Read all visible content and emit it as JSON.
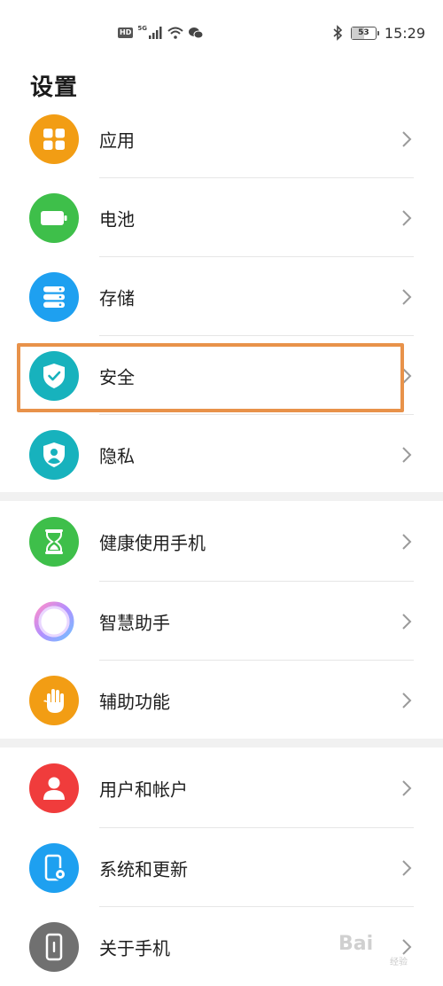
{
  "status_bar": {
    "hd": "HD",
    "network": "5G",
    "time": "15:29",
    "battery_percent": "53",
    "battery_level": 0.53
  },
  "page": {
    "title": "设置"
  },
  "items": [
    {
      "label": "应用",
      "icon": "apps-icon",
      "color": "#f29d14"
    },
    {
      "label": "电池",
      "icon": "battery-icon",
      "color": "#3ebf4a"
    },
    {
      "label": "存储",
      "icon": "storage-icon",
      "color": "#1ea0f0"
    },
    {
      "label": "安全",
      "icon": "shield-check-icon",
      "color": "#17b2bd"
    },
    {
      "label": "隐私",
      "icon": "privacy-shield-icon",
      "color": "#17b2bd"
    },
    {
      "label": "健康使用手机",
      "icon": "hourglass-icon",
      "color": "#3ebf4a"
    },
    {
      "label": "智慧助手",
      "icon": "assistant-ring-icon",
      "color": "#ffffff"
    },
    {
      "label": "辅助功能",
      "icon": "hand-icon",
      "color": "#f29d14"
    },
    {
      "label": "用户和帐户",
      "icon": "user-icon",
      "color": "#f03c3c"
    },
    {
      "label": "系统和更新",
      "icon": "phone-gear-icon",
      "color": "#1ea0f0"
    },
    {
      "label": "关于手机",
      "icon": "phone-info-icon",
      "color": "#707070"
    }
  ],
  "highlight_color": "#e8924a",
  "watermark": {
    "text": "Bai",
    "sub": "经验"
  }
}
